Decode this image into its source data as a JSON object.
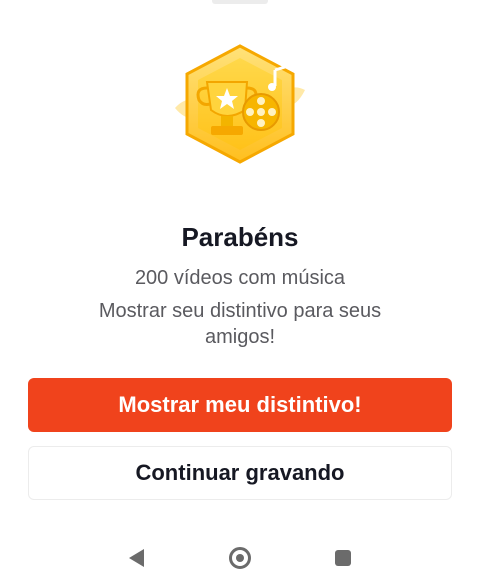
{
  "dialog": {
    "title": "Parabéns",
    "subtitle": "200 vídeos com música",
    "description": "Mostrar seu distintivo para seus amigos!",
    "badge_icon": "trophy-badge-icon",
    "primary_button": {
      "label": "Mostrar meu distintivo!",
      "color": "#f0431c"
    },
    "secondary_button": {
      "label": "Continuar gravando"
    }
  },
  "system_nav": {
    "back_icon": "back-triangle-icon",
    "home_icon": "home-circle-icon",
    "recents_icon": "recents-square-icon"
  }
}
